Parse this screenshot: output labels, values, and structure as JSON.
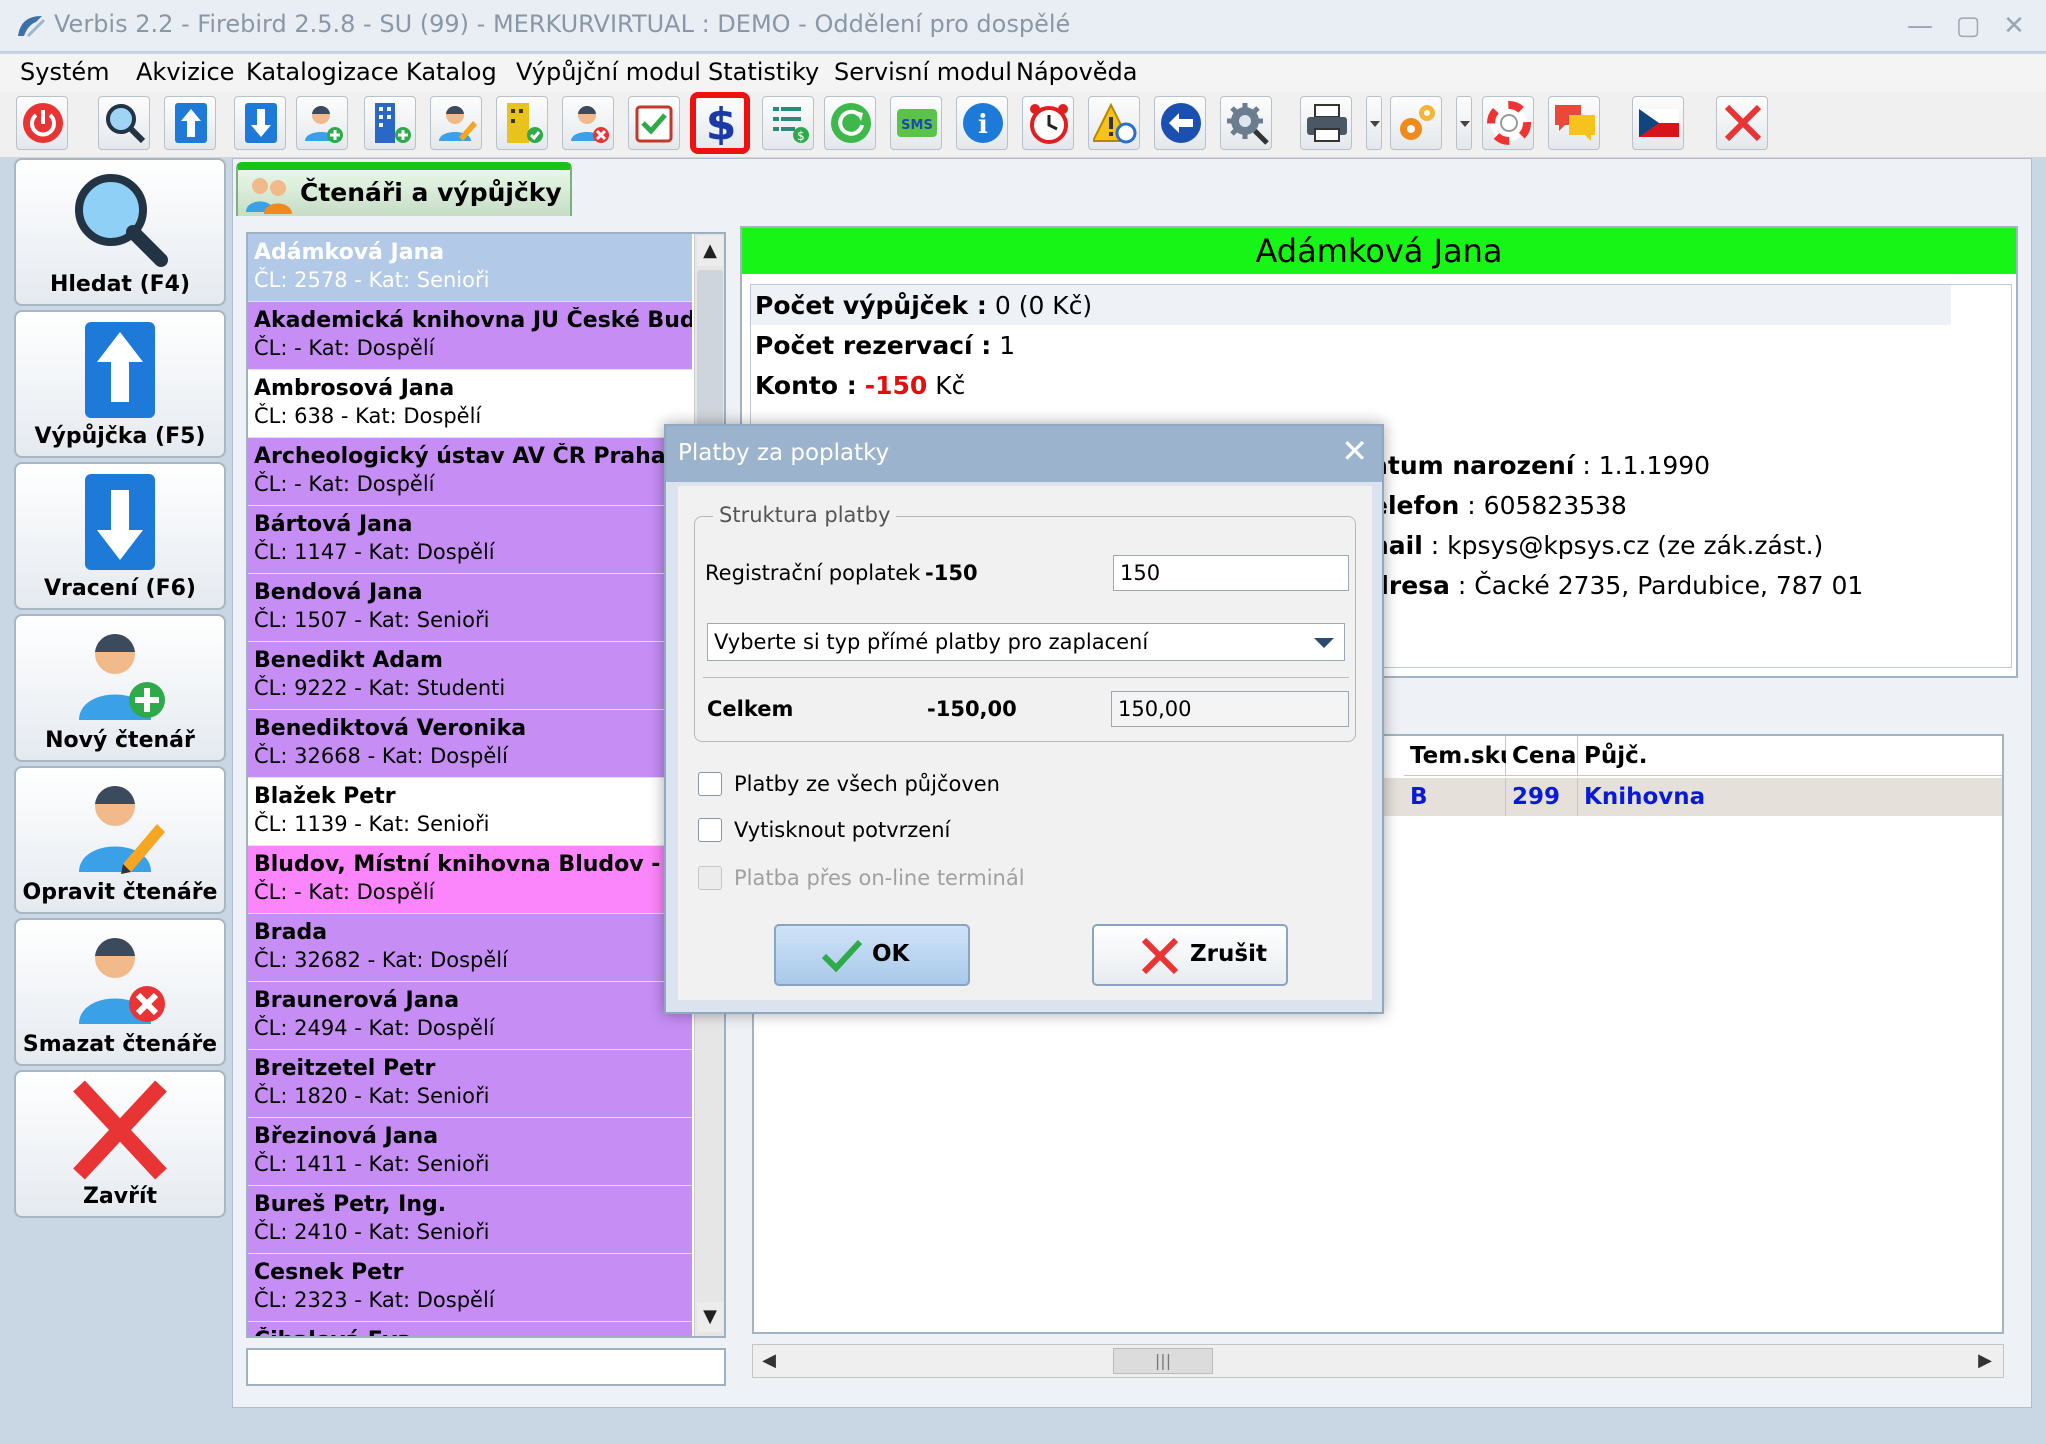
{
  "window": {
    "title": "Verbis 2.2 - Firebird 2.5.8 - SU (99) - MERKURVIRTUAL : DEMO - Oddělení pro dospělé",
    "minimize": "—",
    "maximize": "▢",
    "close": "✕"
  },
  "menu": [
    "Systém",
    "Akvizice",
    "Katalogizace",
    "Katalog",
    "Výpůjční modul",
    "Statistiky",
    "Servisní modul",
    "Nápověda"
  ],
  "left_buttons": [
    "Hledat (F4)",
    "Výpůjčka (F5)",
    "Vracení (F6)",
    "Nový čtenář",
    "Opravit čtenáře",
    "Smazat čtenáře",
    "Zavřít"
  ],
  "tab": {
    "label": "Čtenáři a výpůjčky"
  },
  "readers": [
    {
      "name": "Adámková Jana",
      "sub": "ČL: 2578 - Kat: Senioři",
      "color": "#b3c9e8",
      "selected": true
    },
    {
      "name": "Akademická knihovna JU České Bud...",
      "sub": "ČL:  - Kat: Dospělí",
      "color": "#c68df5"
    },
    {
      "name": "Ambrosová Jana",
      "sub": "ČL: 638 - Kat: Dospělí",
      "color": "#ffffff"
    },
    {
      "name": "Archeologický ústav AV ČR Praha -",
      "sub": "ČL:  - Kat: Dospělí",
      "color": "#c68df5"
    },
    {
      "name": "Bártová Jana",
      "sub": "ČL: 1147 - Kat: Dospělí",
      "color": "#c68df5"
    },
    {
      "name": "Bendová Jana",
      "sub": "ČL: 1507 - Kat: Senioři",
      "color": "#c68df5"
    },
    {
      "name": "Benedikt Adam",
      "sub": "ČL: 9222 - Kat: Studenti",
      "color": "#c68df5"
    },
    {
      "name": "Benediktová Veronika",
      "sub": "ČL: 32668 - Kat: Dospělí",
      "color": "#c68df5"
    },
    {
      "name": "Blažek Petr",
      "sub": "ČL: 1139 - Kat: Senioři",
      "color": "#ffffff"
    },
    {
      "name": "Bludov, Místní knihovna Bludov -",
      "sub": "ČL:  - Kat: Dospělí",
      "color": "#fb86fb"
    },
    {
      "name": "Brada",
      "sub": "ČL: 32682 - Kat: Dospělí",
      "color": "#c68df5"
    },
    {
      "name": "Braunerová Jana",
      "sub": "ČL: 2494 - Kat: Dospělí",
      "color": "#c68df5"
    },
    {
      "name": "Breitzetel Petr",
      "sub": "ČL: 1820 - Kat: Senioři",
      "color": "#c68df5"
    },
    {
      "name": "Březinová Jana",
      "sub": "ČL: 1411 - Kat: Senioři",
      "color": "#c68df5"
    },
    {
      "name": "Bureš Petr, Ing.",
      "sub": "ČL: 2410 - Kat: Senioři",
      "color": "#c68df5"
    },
    {
      "name": "Cesnek Petr",
      "sub": "ČL: 2323 - Kat: Dospělí",
      "color": "#c68df5"
    },
    {
      "name": "Čihalová Eva",
      "sub": "",
      "color": "#c68df5"
    }
  ],
  "detail": {
    "name": "Adámková Jana",
    "loans_label": "Počet výpůjček :",
    "loans_value": " 0   (0 Kč)",
    "reservations_label": "Počet rezervací :",
    "reservations_value": " 1",
    "account_label": "Konto :",
    "account_value": "-150",
    "account_currency": " Kč",
    "birth_label": "atum narození",
    "birth_value": " : 1.1.1990",
    "phone_label": "elefon",
    "phone_value": " : 605823538",
    "email_label": "nail",
    "email_value": " : kpsys@kpsys.cz (ze zák.zást.)",
    "address_label": "dresa",
    "address_value": " : Čacké 2735, Pardubice, 787 01"
  },
  "table": {
    "headers": [
      "Tem.sku",
      "Cena",
      "Půjč."
    ],
    "row": [
      "B",
      "299",
      "Knihovna"
    ]
  },
  "dialog": {
    "title": "Platby za poplatky",
    "close": "✕",
    "group_label": "Struktura platby",
    "fee_label": "Registrační poplatek",
    "fee_amount": "-150",
    "fee_input": "150",
    "payment_type": "Vyberte si typ přímé platby pro zaplacení",
    "total_label": "Celkem",
    "total_amount": "-150,00",
    "total_input": "150,00",
    "check_all": "Platby ze všech půjčoven",
    "check_print": "Vytisknout potvrzení",
    "check_terminal": "Platba přes on-line terminál",
    "ok": "OK",
    "cancel": "Zrušit"
  },
  "hscroll_thumb": "|||"
}
